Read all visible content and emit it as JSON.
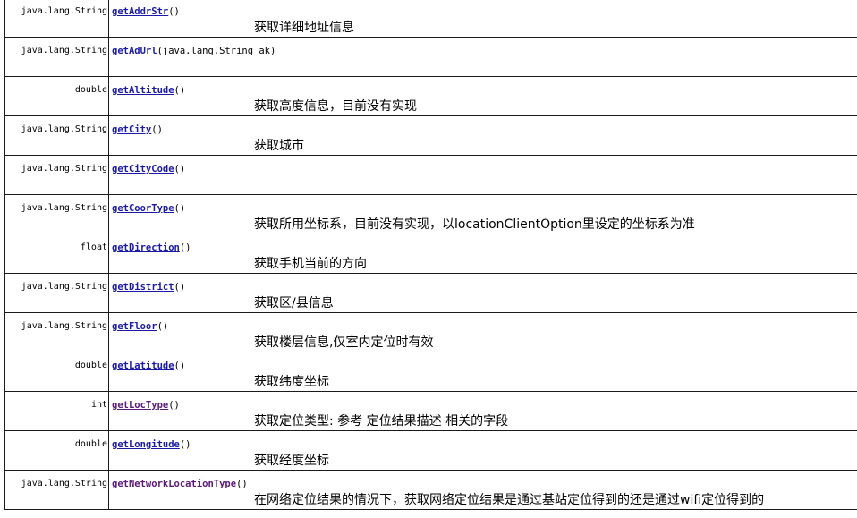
{
  "methods": [
    {
      "type": "java.lang.String",
      "name": "getAddrStr",
      "params": "()",
      "desc": "获取详细地址信息"
    },
    {
      "type": "java.lang.String",
      "name": "getAdUrl",
      "params": "(java.lang.String  ak)",
      "desc": ""
    },
    {
      "type": "double",
      "name": "getAltitude",
      "params": "()",
      "desc": "获取高度信息，目前没有实现"
    },
    {
      "type": "java.lang.String",
      "name": "getCity",
      "params": "()",
      "desc": "获取城市"
    },
    {
      "type": "java.lang.String",
      "name": "getCityCode",
      "params": "()",
      "desc": ""
    },
    {
      "type": "java.lang.String",
      "name": "getCoorType",
      "params": "()",
      "desc": "获取所用坐标系，目前没有实现，以locationClientOption里设定的坐标系为准"
    },
    {
      "type": "float",
      "name": "getDirection",
      "params": "()",
      "desc": "获取手机当前的方向"
    },
    {
      "type": "java.lang.String",
      "name": "getDistrict",
      "params": "()",
      "desc": "获取区/县信息"
    },
    {
      "type": "java.lang.String",
      "name": "getFloor",
      "params": "()",
      "desc": "获取楼层信息,仅室内定位时有效"
    },
    {
      "type": "double",
      "name": "getLatitude",
      "params": "()",
      "desc": "获取纬度坐标"
    },
    {
      "type": "int",
      "name": "getLocType",
      "params": "()",
      "desc": "获取定位类型: 参考 定位结果描述 相关的字段"
    },
    {
      "type": "double",
      "name": "getLongitude",
      "params": "()",
      "desc": "获取经度坐标"
    },
    {
      "type": "java.lang.String",
      "name": "getNetworkLocationType",
      "params": "()",
      "desc": "在网络定位结果的情况下，获取网络定位结果是通过基站定位得到的还是通过wifi定位得到的"
    }
  ],
  "colors": {
    "link": "#1a1aa6",
    "visited_link": "#5a1a7a",
    "border": "#1a1a1a"
  }
}
